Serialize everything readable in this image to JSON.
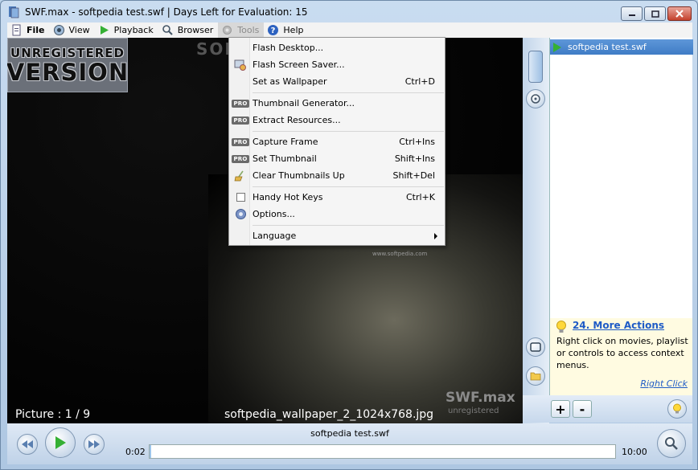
{
  "window": {
    "title": "SWF.max - softpedia test.swf | Days Left for Evaluation: 15"
  },
  "menubar": {
    "items": [
      {
        "label": "File",
        "icon": "file-icon"
      },
      {
        "label": "View",
        "icon": "view-icon"
      },
      {
        "label": "Playback",
        "icon": "play-icon"
      },
      {
        "label": "Browser",
        "icon": "browser-icon"
      },
      {
        "label": "Tools",
        "icon": "gear-icon"
      },
      {
        "label": "Help",
        "icon": "help-icon"
      }
    ]
  },
  "tools_menu": {
    "items": [
      {
        "label": "Flash Desktop...",
        "shortcut": "",
        "icon": "none"
      },
      {
        "label": "Flash Screen Saver...",
        "shortcut": "",
        "icon": "screensaver-icon"
      },
      {
        "label": "Set as Wallpaper",
        "shortcut": "Ctrl+D",
        "icon": "none"
      },
      {
        "label": "Thumbnail Generator...",
        "shortcut": "",
        "icon": "pro-badge"
      },
      {
        "label": "Extract Resources...",
        "shortcut": "",
        "icon": "pro-badge"
      },
      {
        "label": "Capture Frame",
        "shortcut": "Ctrl+Ins",
        "icon": "pro-badge"
      },
      {
        "label": "Set Thumbnail",
        "shortcut": "Shift+Ins",
        "icon": "pro-badge"
      },
      {
        "label": "Clear Thumbnails Up",
        "shortcut": "Shift+Del",
        "icon": "broom-icon"
      },
      {
        "label": "Handy Hot Keys",
        "shortcut": "Ctrl+K",
        "icon": "checkbox"
      },
      {
        "label": "Options...",
        "shortcut": "",
        "icon": "options-gear-icon"
      },
      {
        "label": "Language",
        "shortcut": "",
        "icon": "submenu-arrow"
      }
    ],
    "pro_label": "PRO"
  },
  "player": {
    "badge_line1": "UNREGISTERED",
    "badge_line2": "VERSION",
    "watermark": "SOFT",
    "image_url_text": "www.softpedia.com",
    "picture_counter": "Picture : 1 / 9",
    "file_label": "softpedia_wallpaper_2_1024x768.jpg",
    "brand_logo": "SWF.max",
    "brand_sub": "unregistered"
  },
  "playlist": {
    "items": [
      {
        "label": "softpedia test.swf",
        "selected": true
      }
    ]
  },
  "tips": {
    "title": "24. More Actions",
    "body": "Right click on movies, playlist or controls to access context menus.",
    "link": "Right Click"
  },
  "playlist_toolbar": {
    "add_label": "+",
    "remove_label": "-"
  },
  "controls": {
    "now_playing": "softpedia test.swf",
    "time_start": "0:02",
    "time_end": "10:00",
    "progress_fraction": 0.003
  },
  "colors": {
    "accent": "#3f7cc6",
    "play_green": "#35b034",
    "tip_link": "#1e5bc6"
  }
}
